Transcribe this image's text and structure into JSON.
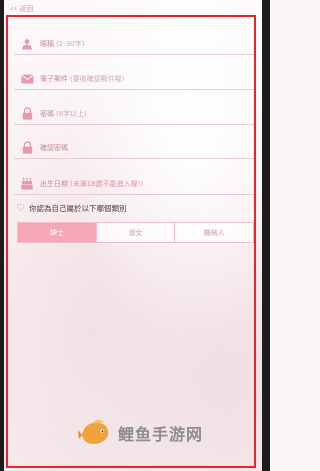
{
  "nav": {
    "back_label": "返回"
  },
  "form": {
    "fields": [
      {
        "icon": "person-icon",
        "label": "暱稱",
        "hint": "(2-30字)"
      },
      {
        "icon": "mail-icon",
        "label": "電子郵件",
        "hint": "(要收確認郵件喔)"
      },
      {
        "icon": "lock-icon",
        "label": "密碼",
        "hint": "(8字以上)"
      },
      {
        "icon": "lock-icon",
        "label": "確認密碼",
        "hint": ""
      },
      {
        "icon": "cake-icon",
        "label": "出生日期",
        "hint": "(未滿18歲不能進入喔!)"
      }
    ],
    "question": "你認為自己屬於以下哪個類別",
    "categories": [
      "紳士",
      "淑女",
      "機械人"
    ],
    "selected_category": "紳士"
  },
  "colors": {
    "frame": "#e8242c",
    "accent": "#f4a8b8",
    "icon": "#e79aab"
  },
  "watermark": {
    "text": "鲤鱼手游网"
  }
}
